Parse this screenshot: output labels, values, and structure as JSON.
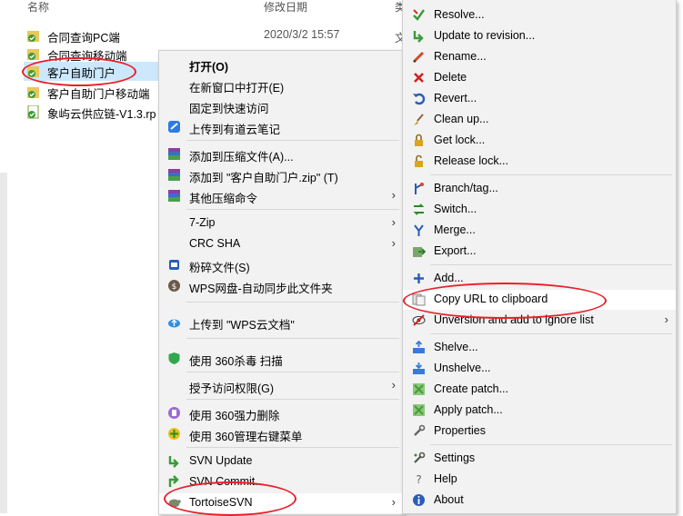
{
  "explorer": {
    "columns": {
      "name": "名称",
      "modified": "修改日期",
      "type_partial": "类"
    },
    "files": [
      {
        "name": "合同查询PC端",
        "modified": "2020/3/2 15:57",
        "type_partial": "文"
      },
      {
        "name": "合同查询移动端",
        "modified": "",
        "type_partial": ""
      },
      {
        "name": "客户自助门户",
        "modified": "",
        "type_partial": ""
      },
      {
        "name": "客户自助门户移动端",
        "modified": "",
        "type_partial": ""
      },
      {
        "name": "象屿云供应链-V1.3.rp",
        "modified": "",
        "type_partial": ""
      }
    ]
  },
  "context_menu": {
    "items": [
      {
        "label": "打开(O)",
        "icon": "none"
      },
      {
        "label": "在新窗口中打开(E)",
        "icon": "none"
      },
      {
        "label": "固定到快速访问",
        "icon": "none"
      },
      {
        "label": "上传到有道云笔记",
        "icon": "youdao-note-icon"
      },
      {
        "label": "添加到压缩文件(A)...",
        "icon": "winrar-icon"
      },
      {
        "label": "添加到 \"客户自助门户.zip\" (T)",
        "icon": "winrar-icon"
      },
      {
        "label": "其他压缩命令",
        "icon": "winrar-icon"
      },
      {
        "label": "7-Zip",
        "icon": "none"
      },
      {
        "label": "CRC SHA",
        "icon": "none"
      },
      {
        "label": "粉碎文件(S)",
        "icon": "shredder-icon"
      },
      {
        "label": "WPS网盘-自动同步此文件夹",
        "icon": "wps-sync-icon"
      },
      {
        "label": "上传到 \"WPS云文档\"",
        "icon": "cloud-upload-icon"
      },
      {
        "label": "使用 360杀毒 扫描",
        "icon": "360-antivirus-icon"
      },
      {
        "label": "授予访问权限(G)",
        "icon": "none"
      },
      {
        "label": "使用 360强力删除",
        "icon": "360-delete-icon"
      },
      {
        "label": "使用 360管理右键菜单",
        "icon": "360-menu-icon"
      },
      {
        "label": "SVN Update",
        "icon": "svn-update-icon"
      },
      {
        "label": "SVN Commit...",
        "icon": "svn-commit-icon"
      },
      {
        "label": "TortoiseSVN",
        "icon": "tortoisesvn-icon"
      }
    ]
  },
  "svn_menu": {
    "items": [
      {
        "label": "Resolve...",
        "icon": "resolve-icon"
      },
      {
        "label": "Update to revision...",
        "icon": "update-revision-icon"
      },
      {
        "label": "Rename...",
        "icon": "rename-icon"
      },
      {
        "label": "Delete",
        "icon": "delete-icon"
      },
      {
        "label": "Revert...",
        "icon": "revert-icon"
      },
      {
        "label": "Clean up...",
        "icon": "cleanup-icon"
      },
      {
        "label": "Get lock...",
        "icon": "lock-icon"
      },
      {
        "label": "Release lock...",
        "icon": "unlock-icon"
      },
      {
        "label": "Branch/tag...",
        "icon": "branch-icon"
      },
      {
        "label": "Switch...",
        "icon": "switch-icon"
      },
      {
        "label": "Merge...",
        "icon": "merge-icon"
      },
      {
        "label": "Export...",
        "icon": "export-icon"
      },
      {
        "label": "Add...",
        "icon": "add-icon"
      },
      {
        "label": "Copy URL to clipboard",
        "icon": "copy-url-icon"
      },
      {
        "label": "Unversion and add to ignore list",
        "icon": "ignore-icon"
      },
      {
        "label": "Shelve...",
        "icon": "shelve-icon"
      },
      {
        "label": "Unshelve...",
        "icon": "unshelve-icon"
      },
      {
        "label": "Create patch...",
        "icon": "create-patch-icon"
      },
      {
        "label": "Apply patch...",
        "icon": "apply-patch-icon"
      },
      {
        "label": "Properties",
        "icon": "properties-icon"
      },
      {
        "label": "Settings",
        "icon": "settings-icon"
      },
      {
        "label": "Help",
        "icon": "help-icon"
      },
      {
        "label": "About",
        "icon": "about-icon"
      }
    ]
  },
  "glyphs": {
    "submenu_arrow": "›"
  },
  "colors": {
    "selection": "#cce8ff",
    "annotation_circle": "#e8202a",
    "menu_bg": "#f2f2f2",
    "svn_green": "#3a9a3a"
  }
}
